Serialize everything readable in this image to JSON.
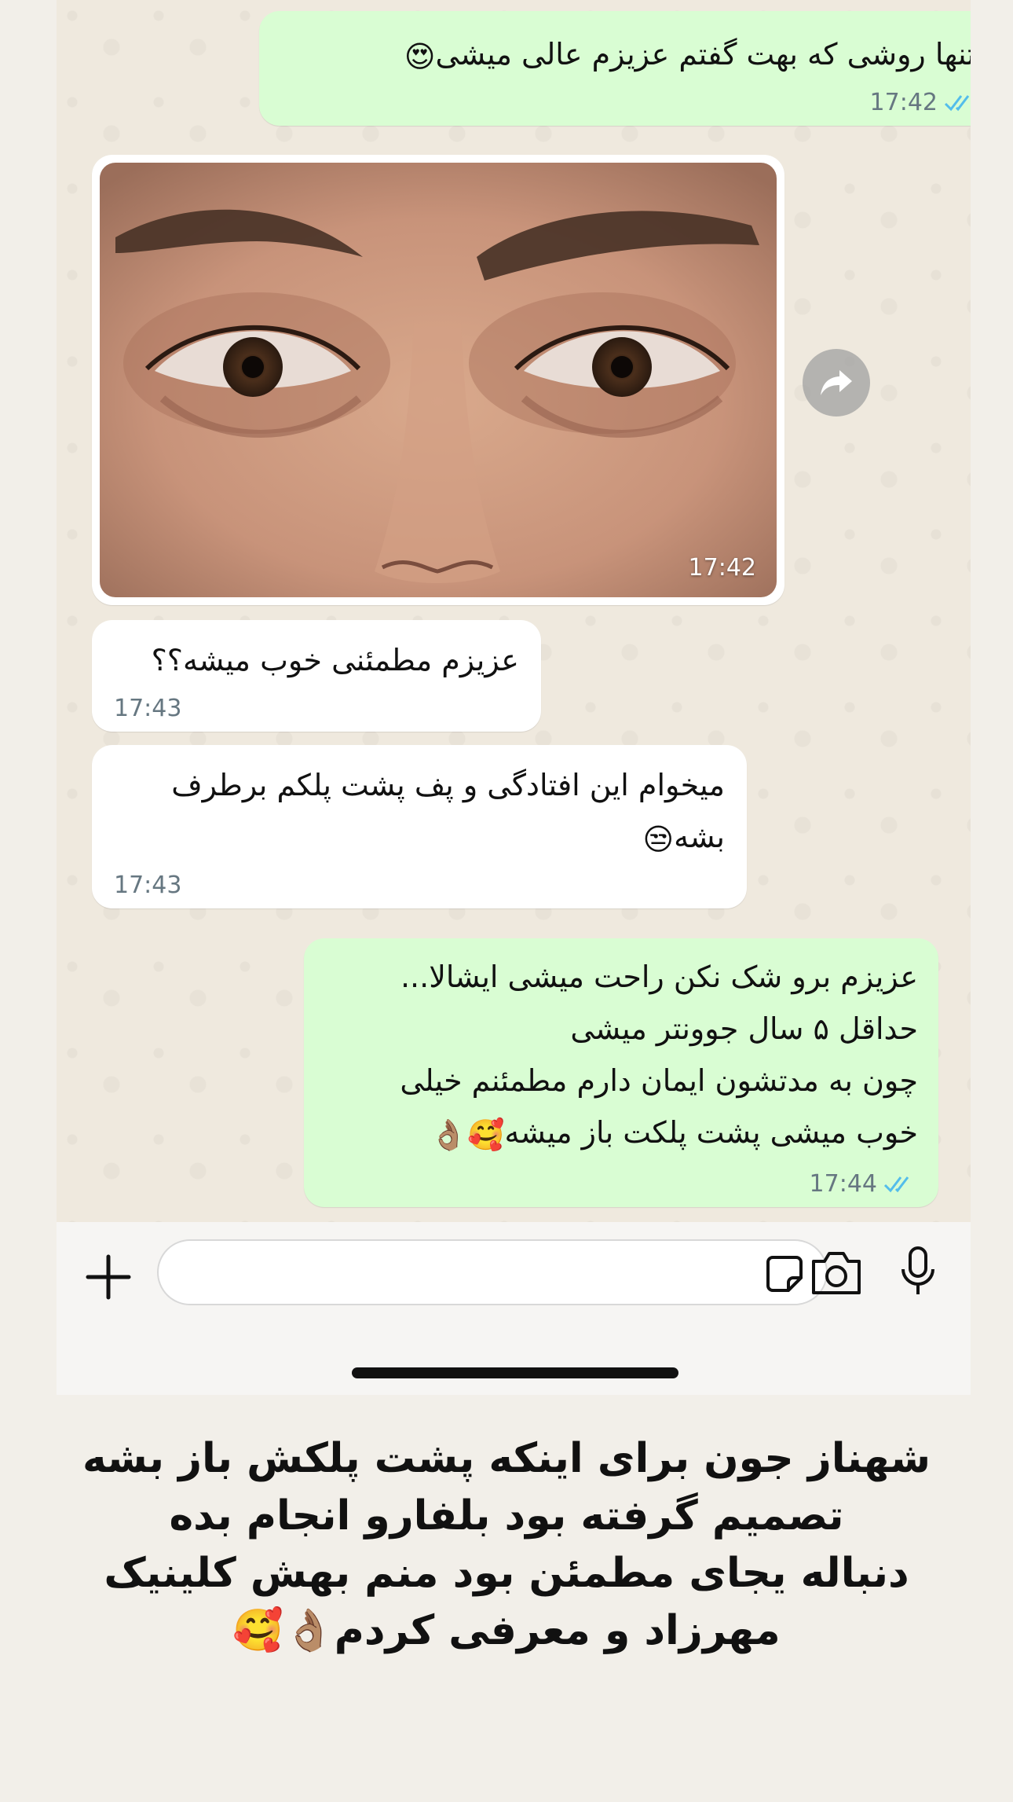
{
  "messages": [
    {
      "id": "m1",
      "direction": "out",
      "text": "تنها روشی که بهت گفتم عزیزم عالی میشی",
      "emoji": "😍",
      "time": "17:42",
      "read": true
    },
    {
      "id": "m2",
      "direction": "in",
      "type": "image",
      "image_alt": "eyes-closeup-photo",
      "time": "17:42"
    },
    {
      "id": "m3",
      "direction": "in",
      "text": "عزیزم مطمئنی خوب میشه؟؟",
      "time": "17:43"
    },
    {
      "id": "m4",
      "direction": "in",
      "lines": [
        "میخوام این افتادگی و پف پشت پلکم برطرف",
        "بشه"
      ],
      "emoji": "😒",
      "time": "17:43"
    },
    {
      "id": "m5",
      "direction": "out",
      "lines": [
        "عزیزم برو شک نکن راحت میشی ایشالا...",
        "حداقل ۵ سال جوونتر میشی",
        "چون به مدتشون ایمان دارم مطمئنم خیلی",
        "خوب میشی پشت پلکت باز میشه"
      ],
      "emoji": "🥰👌🏽",
      "time": "17:44",
      "read": true
    }
  ],
  "input": {
    "placeholder": ""
  },
  "icons": {
    "plus": "plus-icon",
    "sticker": "sticker-icon",
    "camera": "camera-icon",
    "mic": "microphone-icon",
    "forward": "forward-icon",
    "ticks": "double-check-icon"
  },
  "colors": {
    "outgoing_bubble": "#d9fdd3",
    "incoming_bubble": "#ffffff",
    "read_ticks": "#53bdeb",
    "chat_bg": "#efe9de"
  },
  "caption": {
    "lines": [
      "شهناز جون برای اینکه پشت پلکش باز بشه",
      "تصمیم گرفته بود بلفارو انجام بده",
      "دنباله یجای مطمئن بود منم بهش کلینیک",
      "مهرزاد و معرفی کردم"
    ],
    "emoji": "👌🏽🥰"
  }
}
